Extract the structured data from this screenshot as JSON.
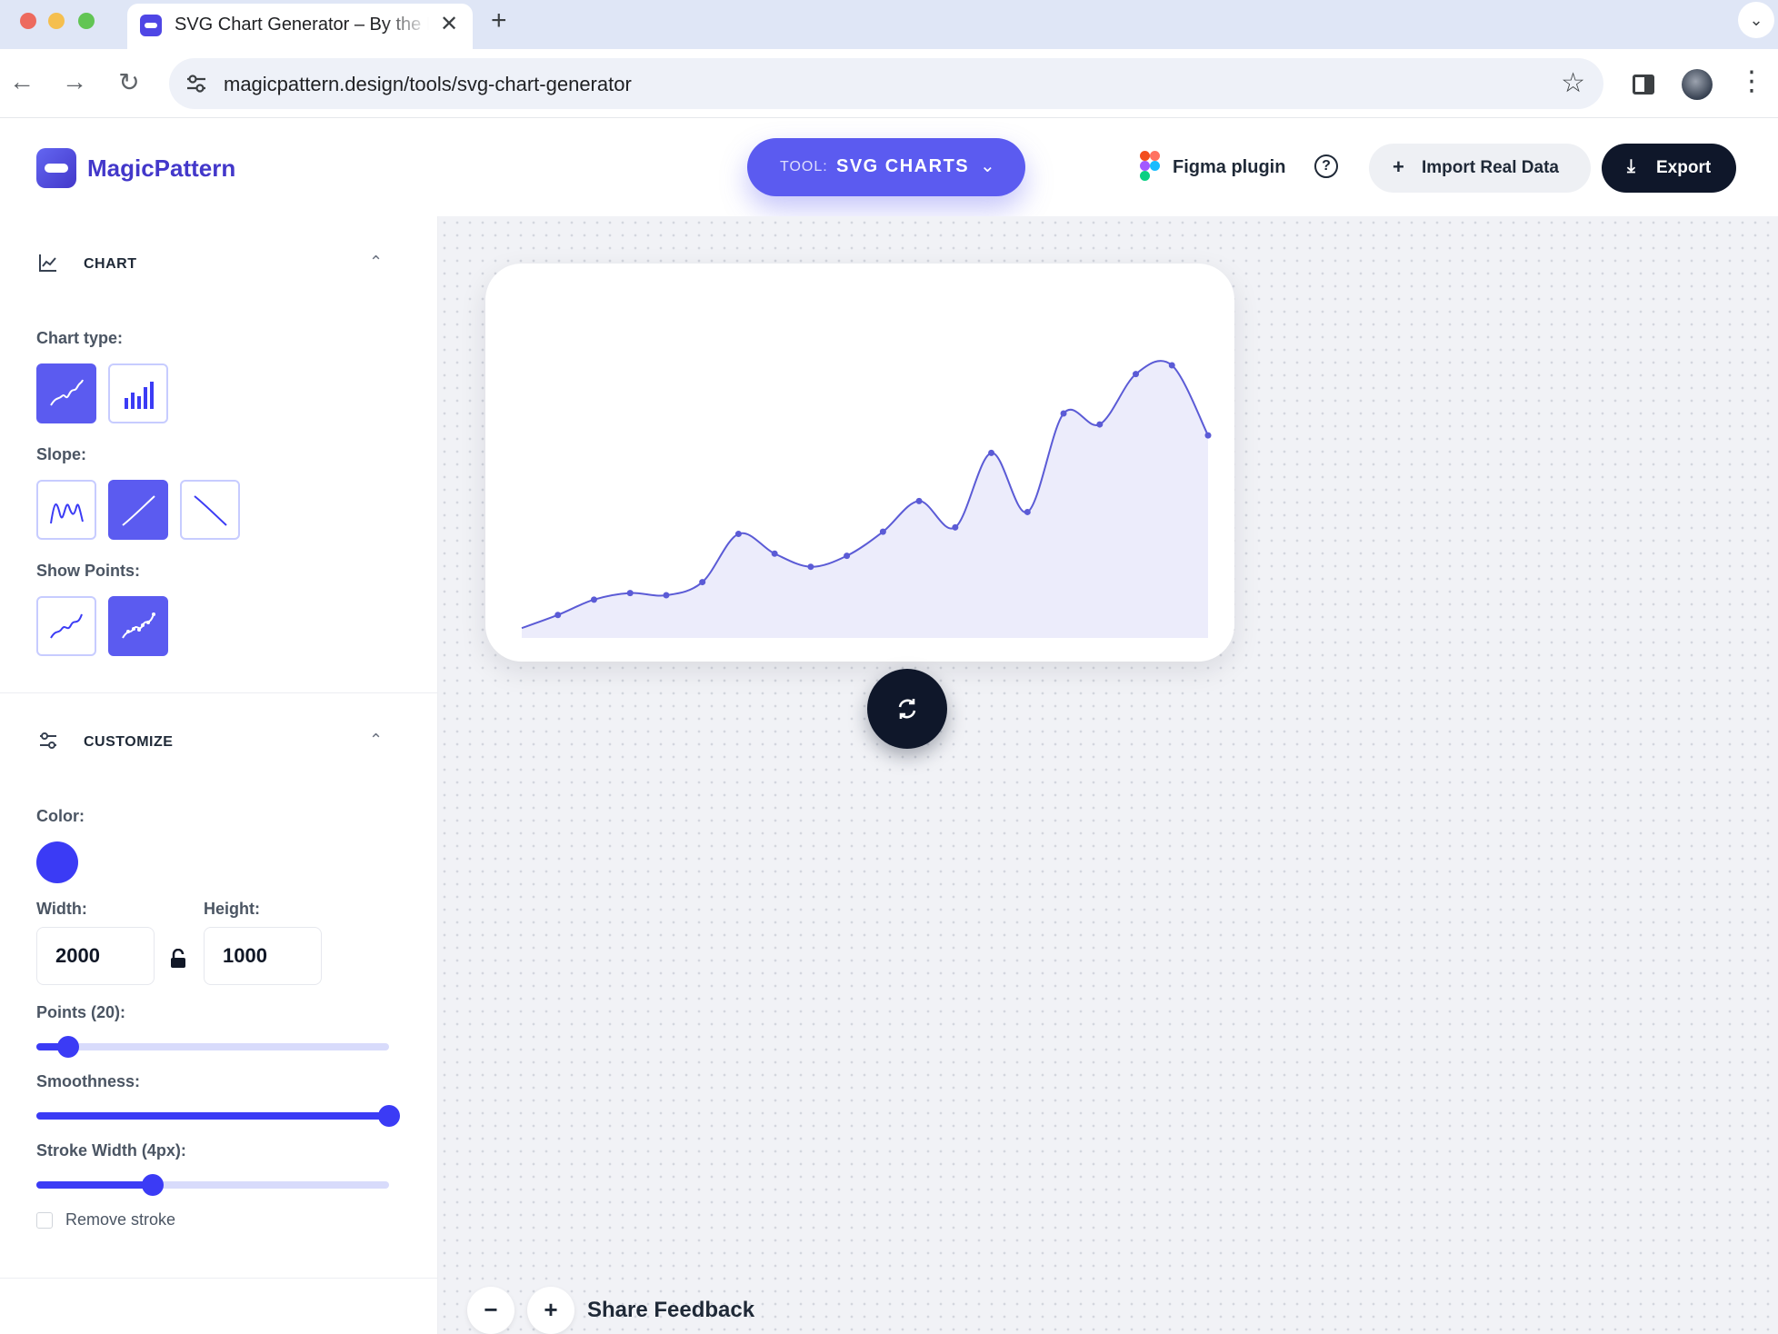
{
  "browser": {
    "tab_title": "SVG Chart Generator – By the MagicPattern",
    "tab_close": "✕",
    "new_tab": "+",
    "url": "magicpattern.design/tools/svg-chart-generator",
    "back": "←",
    "forward": "→",
    "reload": "↻",
    "star": "☆",
    "menu": "⋮",
    "tab_menu": "⌄"
  },
  "header": {
    "logo_text": "MagicPattern",
    "tool_prefix": "TOOL:",
    "tool_name": "SVG CHARTS",
    "tool_chevron": "⌄",
    "figma_label": "Figma plugin",
    "help": "?",
    "import_plus": "+",
    "import_label": "Import Real Data",
    "export_icon": "⤓",
    "export_label": "Export"
  },
  "sidebar": {
    "chart_section": {
      "title": "CHART",
      "chevron": "⌃",
      "chart_type_label": "Chart type:",
      "chart_types": [
        {
          "name": "line",
          "selected": true
        },
        {
          "name": "bar",
          "selected": false
        }
      ],
      "slope_label": "Slope:",
      "slopes": [
        {
          "name": "random",
          "selected": false
        },
        {
          "name": "up",
          "selected": true
        },
        {
          "name": "down",
          "selected": false
        }
      ],
      "show_points_label": "Show Points:",
      "show_points": [
        {
          "name": "no-points",
          "selected": false
        },
        {
          "name": "with-points",
          "selected": true
        }
      ]
    },
    "customize_section": {
      "title": "CUSTOMIZE",
      "chevron": "⌃",
      "color_label": "Color:",
      "color": "#3b3bf5",
      "width_label": "Width:",
      "width_value": "2000",
      "height_label": "Height:",
      "height_value": "1000",
      "points_label": "Points (20):",
      "points_level": 0.09,
      "smoothness_label": "Smoothness:",
      "smoothness_level": 1.0,
      "stroke_label": "Stroke Width (4px):",
      "stroke_level": 0.33,
      "remove_stroke_label": "Remove stroke",
      "remove_stroke_checked": false
    }
  },
  "canvas": {
    "zoom_out": "−",
    "zoom_in": "+",
    "feedback_label": "Share Feedback"
  },
  "colors": {
    "accent": "#5b5bf0",
    "chart_line": "#5b5bd6",
    "chart_fill": "#ececfb",
    "dark": "#0f172a"
  },
  "chart_data": {
    "type": "area",
    "points": [
      2,
      8,
      15,
      18,
      17,
      23,
      45,
      36,
      30,
      35,
      46,
      60,
      48,
      82,
      55,
      100,
      95,
      118,
      122,
      90
    ]
  }
}
